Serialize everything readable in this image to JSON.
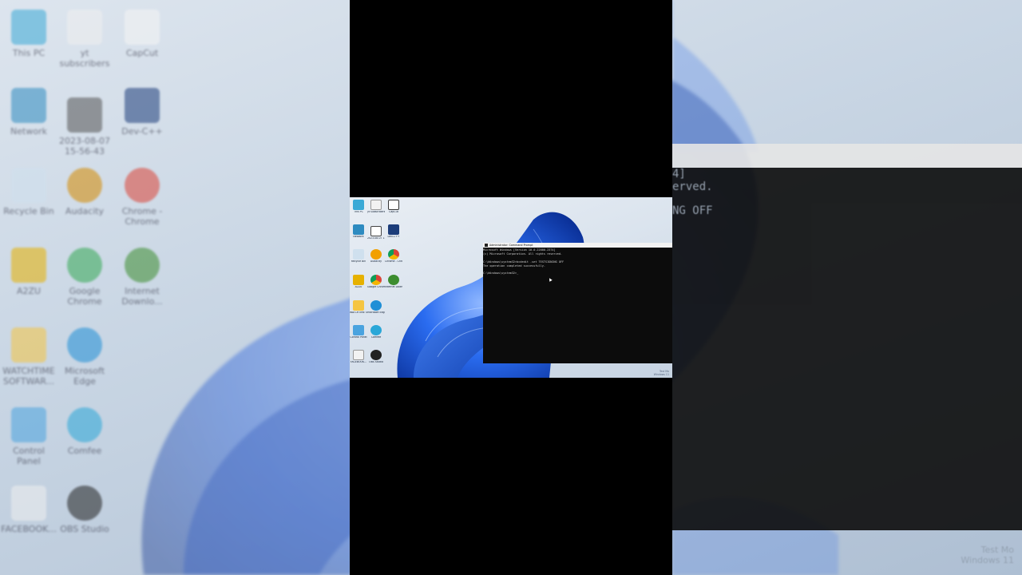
{
  "desktop_icons": [
    {
      "label": "This PC",
      "icon": "monitor-icon",
      "color": "#3aa9d6"
    },
    {
      "label": "yt subscribers",
      "icon": "video-file-icon",
      "color": "#f2f2f2"
    },
    {
      "label": "CapCut",
      "icon": "capcut-icon",
      "color": "#ffffff"
    },
    {
      "label": "Network",
      "icon": "network-icon",
      "color": "#2e8bc0"
    },
    {
      "label": "2023-08-07 15-56-43",
      "icon": "video-thumbnail-icon",
      "color": "#444444"
    },
    {
      "label": "Dev-C++",
      "icon": "devcpp-icon",
      "color": "#1c3d7a"
    },
    {
      "label": "Recycle Bin",
      "icon": "recycle-bin-icon",
      "color": "#cfe0ee"
    },
    {
      "label": "Audacity",
      "icon": "audacity-icon",
      "color": "#f2a000"
    },
    {
      "label": "Chrome - Chrome",
      "icon": "chrome-icon",
      "color": "#db4437"
    },
    {
      "label": "A2ZU",
      "icon": "user-folder-icon",
      "color": "#e6b100"
    },
    {
      "label": "Google Chrome",
      "icon": "chrome-icon",
      "color": "#34a853"
    },
    {
      "label": "Internet Downlo...",
      "icon": "idm-icon",
      "color": "#3c8d2f"
    },
    {
      "label": "WATCHTIME SOFTWAR...",
      "icon": "folder-icon",
      "color": "#f5c542"
    },
    {
      "label": "Microsoft Edge",
      "icon": "edge-icon",
      "color": "#1f8fd6"
    },
    {
      "label": "Control Panel",
      "icon": "control-panel-icon",
      "color": "#4aa3df"
    },
    {
      "label": "Comfee",
      "icon": "comfee-icon",
      "color": "#2aa7d8"
    },
    {
      "label": "FACEBOOK...",
      "icon": "video-file-icon",
      "color": "#f2f2f2"
    },
    {
      "label": "OBS Studio",
      "icon": "obs-icon",
      "color": "#222222"
    }
  ],
  "cmd": {
    "title": "Administrator: Command Prompt",
    "lines": [
      "Microsoft Windows [Version 10.0.22000.2374]",
      "(c) Microsoft Corporation. All rights reserved.",
      "",
      "C:\\Windows\\system32>bcdedit -set TESTSIGNING OFF",
      "The operation completed successfully.",
      "",
      "C:\\Windows\\system32>_"
    ]
  },
  "background_cmd_lines": [
    "4]",
    "erved.",
    "",
    "NG OFF"
  ],
  "system_corner": {
    "line1": "Test Mo",
    "line2": "Windows 11"
  },
  "colors": {
    "accent": "#1a5bd6",
    "console": "#0c0c0c",
    "titlebar": "#f2f2f2"
  }
}
